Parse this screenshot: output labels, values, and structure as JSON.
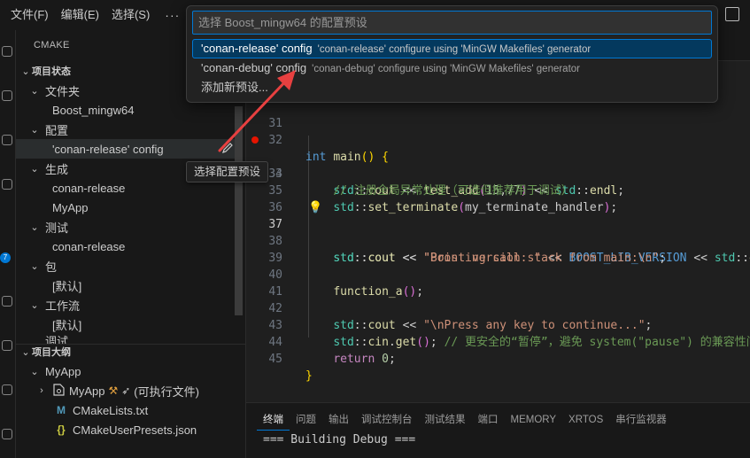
{
  "menu": {
    "file": "文件(F)",
    "edit": "编辑(E)",
    "selection": "选择(S)",
    "more": "···"
  },
  "sidebar": {
    "title": "CMAKE",
    "project_status": {
      "header": "项目状态",
      "folder_label": "文件夹",
      "folder_value": "Boost_mingw64",
      "config_label": "配置",
      "config_value": "'conan-release' config",
      "build_label": "生成",
      "build_items": [
        "conan-release",
        "MyApp"
      ],
      "test_label": "测试",
      "test_value": "conan-release",
      "package_label": "包",
      "package_value": "[默认]",
      "workflow_label": "工作流",
      "workflow_value": "[默认]",
      "cut_label": "调试"
    },
    "outline": {
      "header": "项目大纲",
      "project": "MyApp",
      "target_name": "MyApp",
      "target_desc": "(可执行文件)",
      "files": [
        "CMakeLists.txt",
        "CMakeUserPresets.json"
      ]
    }
  },
  "tooltip": "选择配置预设",
  "quick_pick": {
    "placeholder": "选择 Boost_mingw64 的配置预设",
    "items": [
      {
        "label": "'conan-release' config",
        "description": "'conan-release' configure using 'MinGW Makefiles' generator"
      },
      {
        "label": "'conan-debug' config",
        "description": "'conan-debug' configure using 'MinGW Makefiles' generator"
      },
      {
        "label": "添加新预设...",
        "description": ""
      }
    ]
  },
  "editor": {
    "line_numbers": [
      "31",
      "32",
      "33",
      "34",
      "35",
      "36",
      "37",
      "38",
      "39",
      "40",
      "41",
      "42",
      "43",
      "44",
      "45"
    ],
    "active_line": "37"
  },
  "panel": {
    "tabs": [
      "终端",
      "问题",
      "输出",
      "调试控制台",
      "测试结果",
      "端口",
      "MEMORY",
      "XRTOS",
      "串行监视器"
    ],
    "output": "=== Building Debug ==="
  },
  "colors": {
    "accent": "#0078d4",
    "breakpoint": "#e51400",
    "annotation_arrow": "#e84040"
  },
  "icons": [
    "refresh-icon",
    "collapse-icon",
    "pencil-icon",
    "lightbulb-icon",
    "cmake-icon",
    "json-icon",
    "target-icon"
  ]
}
